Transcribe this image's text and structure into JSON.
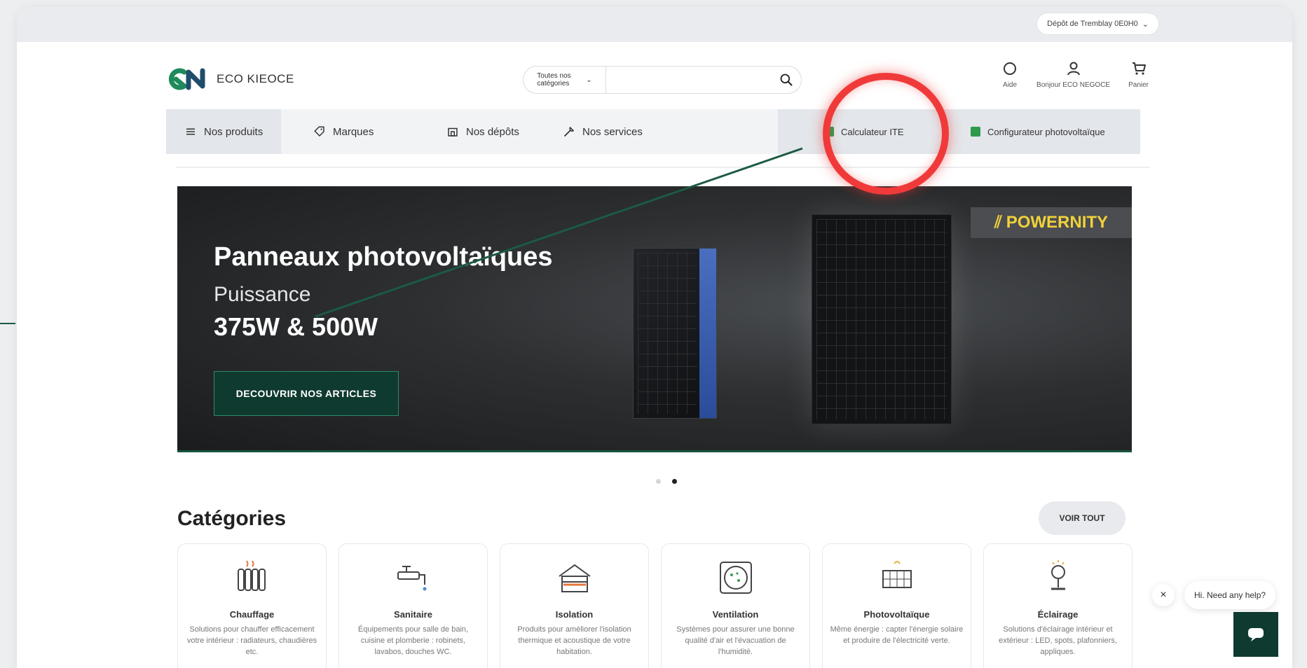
{
  "topbar": {
    "depot_label": "Dépôt de Tremblay 0E0H0"
  },
  "header": {
    "logo_text": "ECO KIEOCE",
    "search_category": "Toutes nos catégories",
    "search_placeholder": "",
    "actions": [
      {
        "icon": "help-icon",
        "label": "Aide"
      },
      {
        "icon": "account-icon",
        "label": "Bonjour ECO NEGOCE"
      },
      {
        "icon": "cart-icon",
        "label": "Panier"
      }
    ]
  },
  "nav": {
    "items": [
      {
        "icon": "menu-icon",
        "label": "Nos produits"
      },
      {
        "icon": "tag-icon",
        "label": "Marques"
      },
      {
        "icon": "depot-icon",
        "label": "Nos dépôts"
      },
      {
        "icon": "services-icon",
        "label": "Nos services"
      }
    ],
    "right_items": [
      {
        "icon": "calculator-icon",
        "label": "Calculateur ITE"
      },
      {
        "icon": "configurator-icon",
        "label": "Configurateur photovoltaïque"
      }
    ]
  },
  "banner": {
    "title": "Panneaux photovoltaïques",
    "subtitle": "Puissance",
    "power": "375W & 500W",
    "cta": "DECOUVRIR NOS ARTICLES",
    "brand": "POWERNITY"
  },
  "carousel": {
    "total": 2,
    "active": 2
  },
  "categories": {
    "title": "Catégories",
    "see_all": "VOIR TOUT",
    "items": [
      {
        "icon": "radiator-icon",
        "name": "Chauffage",
        "desc": "Solutions pour chauffer efficacement votre intérieur : radiateurs, chaudières etc."
      },
      {
        "icon": "faucet-icon",
        "name": "Sanitaire",
        "desc": "Équipements pour salle de bain, cuisine et plomberie : robinets, lavabos, douches WC."
      },
      {
        "icon": "insulation-icon",
        "name": "Isolation",
        "desc": "Produits pour améliorer l'isolation thermique et acoustique de votre habitation."
      },
      {
        "icon": "ventilation-icon",
        "name": "Ventilation",
        "desc": "Systèmes pour assurer une bonne qualité d'air et l'évacuation de l'humidité."
      },
      {
        "icon": "solar-panel-icon",
        "name": "Photovoltaïque",
        "desc": "Même énergie : capter l'énergie solaire et produire de l'électricité verte."
      },
      {
        "icon": "lamp-icon",
        "name": "Éclairage",
        "desc": "Solutions d'éclairage intérieur et extérieur : LED, spots, plafonniers, appliques."
      }
    ]
  },
  "chat": {
    "prompt": "Hi. Need any help?"
  },
  "colors": {
    "accent": "#0f3a30",
    "highlight": "#f03a3a",
    "brand_yellow": "#f0d13a"
  }
}
